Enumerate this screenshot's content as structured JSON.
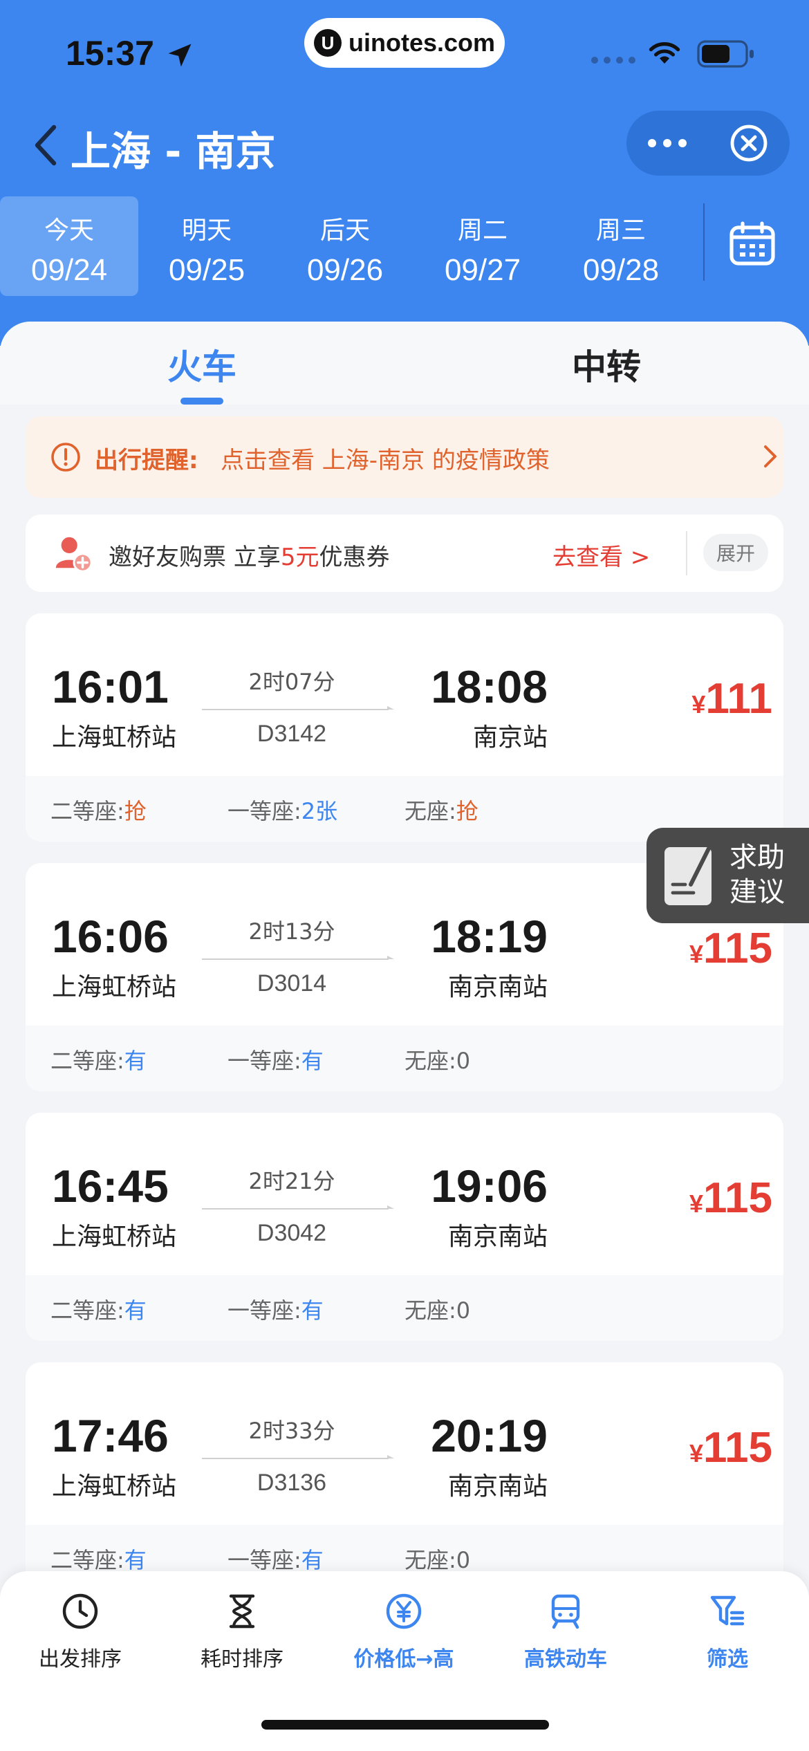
{
  "status_bar": {
    "time": "15:37",
    "watermark_logo": "U",
    "watermark": "uinotes.com"
  },
  "nav": {
    "route_title": "上海 - 南京"
  },
  "dates": [
    {
      "day": "今天",
      "date": "09/24",
      "active": true
    },
    {
      "day": "明天",
      "date": "09/25",
      "active": false
    },
    {
      "day": "后天",
      "date": "09/26",
      "active": false
    },
    {
      "day": "周二",
      "date": "09/27",
      "active": false
    },
    {
      "day": "周三",
      "date": "09/28",
      "active": false
    }
  ],
  "tabs": {
    "train": "火车",
    "transfer": "中转"
  },
  "notice": {
    "label": "出行提醒:",
    "text": "点击查看 上海-南京 的疫情政策"
  },
  "invite": {
    "text_before": "邀好友购票 立享",
    "highlight": "5元",
    "text_after": "优惠券",
    "link": "去查看 >",
    "expand": "展开"
  },
  "seat_labels": {
    "second": "二等座:",
    "first": "一等座:",
    "none": "无座:"
  },
  "trains": [
    {
      "dep_time": "16:01",
      "dep_station": "上海虹桥站",
      "duration": "2时07分",
      "train_no": "D3142",
      "arr_time": "18:08",
      "arr_station": "南京站",
      "currency": "¥",
      "price": "111",
      "second": "抢",
      "first": "2张",
      "none": "抢"
    },
    {
      "dep_time": "16:06",
      "dep_station": "上海虹桥站",
      "duration": "2时13分",
      "train_no": "D3014",
      "arr_time": "18:19",
      "arr_station": "南京南站",
      "currency": "¥",
      "price": "115",
      "second": "有",
      "first": "有",
      "none": "0"
    },
    {
      "dep_time": "16:45",
      "dep_station": "上海虹桥站",
      "duration": "2时21分",
      "train_no": "D3042",
      "arr_time": "19:06",
      "arr_station": "南京南站",
      "currency": "¥",
      "price": "115",
      "second": "有",
      "first": "有",
      "none": "0"
    },
    {
      "dep_time": "17:46",
      "dep_station": "上海虹桥站",
      "duration": "2时33分",
      "train_no": "D3136",
      "arr_time": "20:19",
      "arr_station": "南京南站",
      "currency": "¥",
      "price": "115",
      "second": "有",
      "first": "有",
      "none": "0"
    }
  ],
  "help": {
    "line1": "求助",
    "line2": "建议"
  },
  "bottom_bar": [
    {
      "label": "出发排序",
      "icon": "clock-icon",
      "active": false
    },
    {
      "label": "耗时排序",
      "icon": "hourglass-icon",
      "active": false
    },
    {
      "label": "价格低→高",
      "icon": "yuan-icon",
      "active": true
    },
    {
      "label": "高铁动车",
      "icon": "train-icon",
      "active": true
    },
    {
      "label": "筛选",
      "icon": "filter-icon",
      "active": true
    }
  ],
  "colors": {
    "header_blue": "#3d86f0",
    "price_red": "#e43d33",
    "notice_orange": "#e0622d"
  }
}
